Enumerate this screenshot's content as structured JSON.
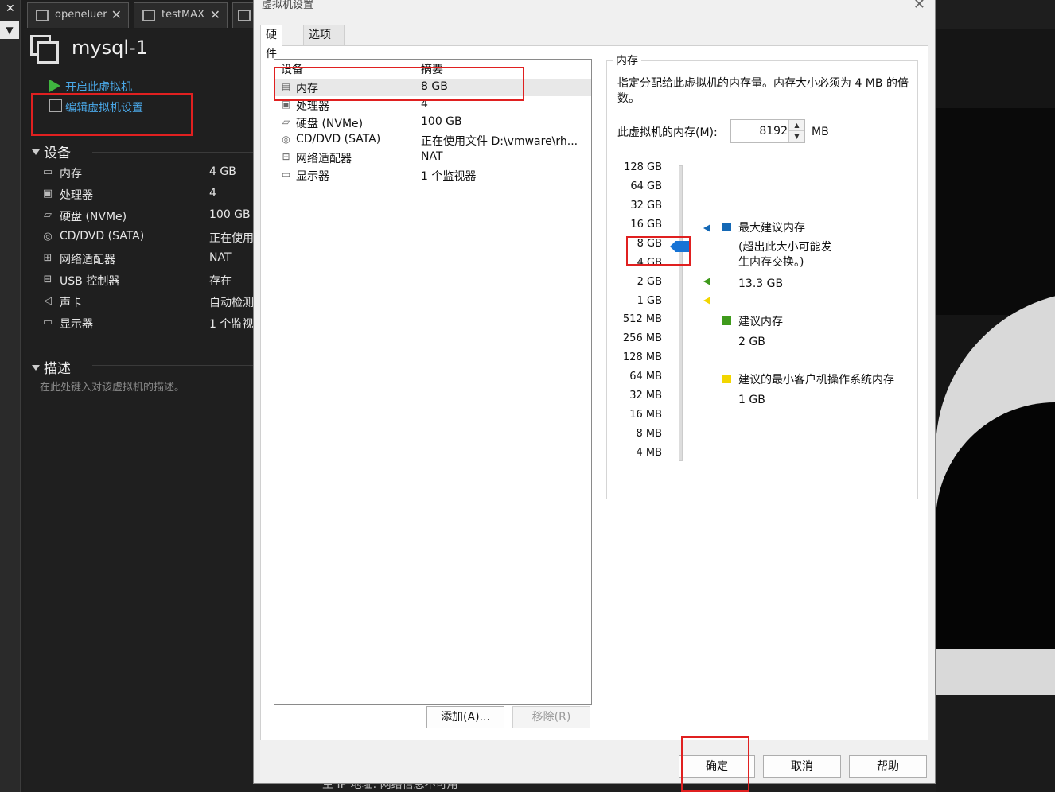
{
  "background": {
    "tabs": [
      {
        "label": "openeluer"
      },
      {
        "label": "testMAX"
      }
    ],
    "vm_title": "mysql-1",
    "actions": {
      "power_on": "开启此虚拟机",
      "edit_settings": "编辑虚拟机设置"
    },
    "devices_header": "设备",
    "devices": [
      {
        "name": "内存",
        "value": "4 GB",
        "icon": "memory-icon"
      },
      {
        "name": "处理器",
        "value": "4",
        "icon": "cpu-icon"
      },
      {
        "name": "硬盘 (NVMe)",
        "value": "100 GB",
        "icon": "disk-icon"
      },
      {
        "name": "CD/DVD (SATA)",
        "value": "正在使用",
        "icon": "cd-icon"
      },
      {
        "name": "网络适配器",
        "value": "NAT",
        "icon": "network-icon"
      },
      {
        "name": "USB 控制器",
        "value": "存在",
        "icon": "usb-icon"
      },
      {
        "name": "声卡",
        "value": "自动检测",
        "icon": "sound-icon"
      },
      {
        "name": "显示器",
        "value": "1 个监视",
        "icon": "display-icon"
      }
    ],
    "description_header": "描述",
    "description_placeholder": "在此处键入对该虚拟机的描述。",
    "bottom_text": "主 IP 地址: 网络信息不可用"
  },
  "dialog": {
    "title": "虚拟机设置",
    "tabs": [
      {
        "label": "硬件",
        "active": true
      },
      {
        "label": "选项",
        "active": false
      }
    ],
    "device_list": {
      "col_device": "设备",
      "col_summary": "摘要",
      "rows": [
        {
          "name": "内存",
          "summary": "8 GB",
          "selected": true,
          "icon": "memory-icon"
        },
        {
          "name": "处理器",
          "summary": "4",
          "icon": "cpu-icon"
        },
        {
          "name": "硬盘 (NVMe)",
          "summary": "100 GB",
          "icon": "disk-icon"
        },
        {
          "name": "CD/DVD (SATA)",
          "summary": "正在使用文件 D:\\vmware\\rh...",
          "icon": "cd-icon"
        },
        {
          "name": "网络适配器",
          "summary": "NAT",
          "icon": "network-icon"
        },
        {
          "name": "显示器",
          "summary": "1 个监视器",
          "icon": "display-icon"
        }
      ]
    },
    "add_button": "添加(A)...",
    "remove_button": "移除(R)",
    "memory": {
      "group_label": "内存",
      "description": "指定分配给此虚拟机的内存量。内存大小必须为 4 MB 的倍数。",
      "field_label": "此虚拟机的内存(M):",
      "value": "8192",
      "unit": "MB",
      "scale_labels": [
        "128 GB",
        "64 GB",
        "32 GB",
        "16 GB",
        "8 GB",
        "4 GB",
        "2 GB",
        "1 GB",
        "512 MB",
        "256 MB",
        "128 MB",
        "64 MB",
        "32 MB",
        "16 MB",
        "8 MB",
        "4 MB"
      ],
      "slider_value": "8 GB",
      "legend": {
        "max_recommended": {
          "label": "最大建议内存",
          "note": "(超出此大小可能发生内存交换。)",
          "value": "13.3 GB",
          "color": "#1468b5"
        },
        "recommended": {
          "label": "建议内存",
          "value": "2 GB",
          "color": "#3f9a1c"
        },
        "min_guest": {
          "label": "建议的最小客户机操作系统内存",
          "value": "1 GB",
          "color": "#f2d600"
        }
      }
    },
    "ok_button": "确定",
    "cancel_button": "取消",
    "help_button": "帮助"
  }
}
